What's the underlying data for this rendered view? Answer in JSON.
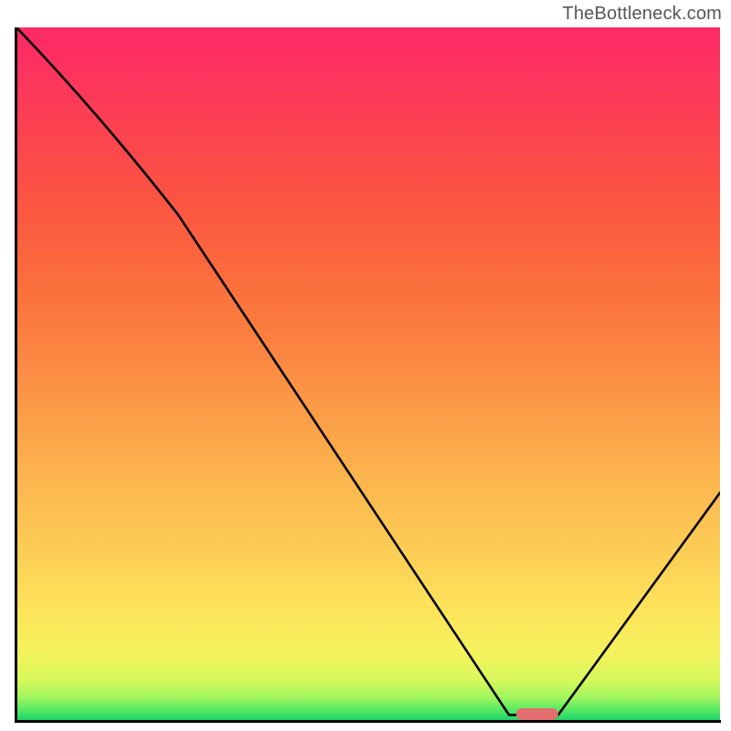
{
  "attribution": "TheBottleneck.com",
  "chart_data": {
    "type": "line",
    "title": "",
    "xlabel": "",
    "ylabel": "",
    "xlim": [
      0,
      100
    ],
    "ylim": [
      0,
      100
    ],
    "x": [
      0,
      23,
      70,
      77,
      100
    ],
    "values": [
      100,
      73,
      1,
      1,
      33
    ],
    "gradient_stops": [
      {
        "pct": 0,
        "color": "#11d169"
      },
      {
        "pct": 3,
        "color": "#a0f55f"
      },
      {
        "pct": 10,
        "color": "#f5f25c"
      },
      {
        "pct": 25,
        "color": "#fccc55"
      },
      {
        "pct": 45,
        "color": "#fb9b47"
      },
      {
        "pct": 65,
        "color": "#fb6a3c"
      },
      {
        "pct": 85,
        "color": "#fc4350"
      },
      {
        "pct": 100,
        "color": "#fd2a66"
      }
    ],
    "marker": {
      "x_center": 74,
      "y": 1,
      "width_pct": 6
    }
  }
}
